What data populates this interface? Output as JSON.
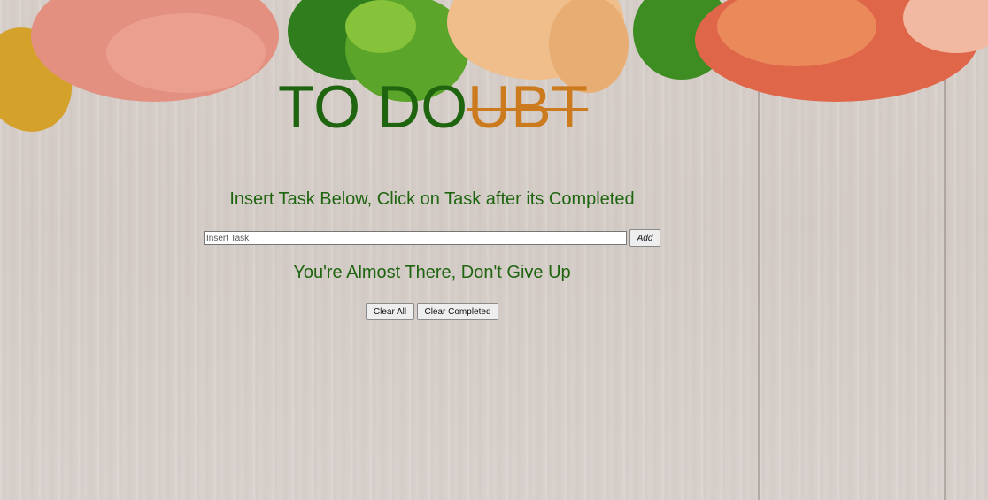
{
  "header": {
    "title_main": "TO DO",
    "title_struck": "UBT"
  },
  "instructions": {
    "text": "Insert Task Below, Click on Task after its Completed"
  },
  "task_form": {
    "placeholder": "Insert Task",
    "value": "",
    "add_label": "Add"
  },
  "motivation": {
    "text": "You're Almost There, Don't Give Up"
  },
  "actions": {
    "clear_all_label": "Clear All",
    "clear_completed_label": "Clear Completed"
  },
  "colors": {
    "title_green": "#1f6510",
    "struck_orange": "#cc7a1e",
    "background_wood": "#d8d0cb"
  }
}
